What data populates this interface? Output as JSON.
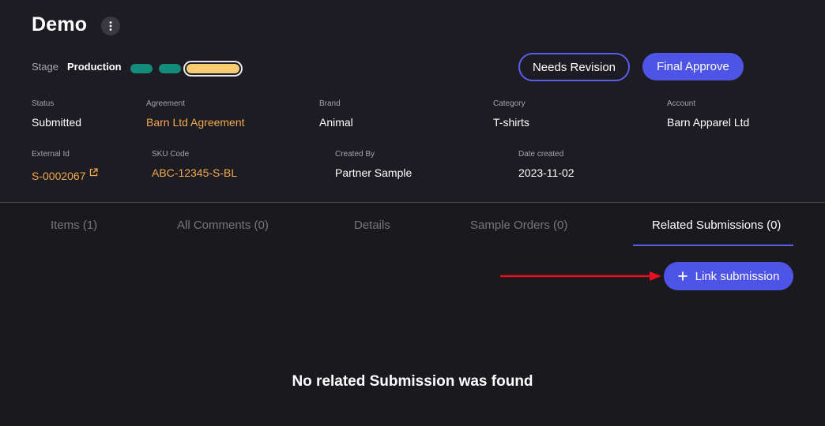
{
  "header": {
    "title": "Demo",
    "stage_label": "Stage",
    "stage_value": "Production",
    "stage_pills": [
      "done",
      "done",
      "current"
    ],
    "actions": {
      "needs_revision": "Needs Revision",
      "final_approve": "Final Approve"
    }
  },
  "fields_row1": [
    {
      "label": "Status",
      "value": "Submitted",
      "link": false
    },
    {
      "label": "Agreement",
      "value": "Barn Ltd Agreement",
      "link": true
    },
    {
      "label": "Brand",
      "value": "Animal",
      "link": false
    },
    {
      "label": "Category",
      "value": "T-shirts",
      "link": false
    },
    {
      "label": "Account",
      "value": "Barn Apparel Ltd",
      "link": false
    }
  ],
  "fields_row2": [
    {
      "label": "External Id",
      "value": "S-0002067",
      "link": true,
      "icon": "external-link-icon"
    },
    {
      "label": "SKU Code",
      "value": "ABC-12345-S-BL",
      "link": true
    },
    {
      "label": "Created By",
      "value": "Partner Sample",
      "link": false
    },
    {
      "label": "Date created",
      "value": "2023-11-02",
      "link": false
    }
  ],
  "tabs": [
    {
      "label": "Items (1)",
      "active": false
    },
    {
      "label": "All Comments (0)",
      "active": false
    },
    {
      "label": "Details",
      "active": false
    },
    {
      "label": "Sample Orders (0)",
      "active": false
    },
    {
      "label": "Related Submissions (0)",
      "active": true
    }
  ],
  "related": {
    "link_button": "Link submission",
    "empty_message": "No related Submission was found"
  },
  "colors": {
    "background": "#1d1c22",
    "accent": "#4e55e6",
    "link": "#f1a94c",
    "stage_done": "#138c79",
    "stage_current": "#f8cc73",
    "annotation_arrow": "#e3101e"
  },
  "icons": [
    "more-vertical-icon",
    "external-link-icon",
    "plus-icon",
    "arrow-right-icon"
  ]
}
